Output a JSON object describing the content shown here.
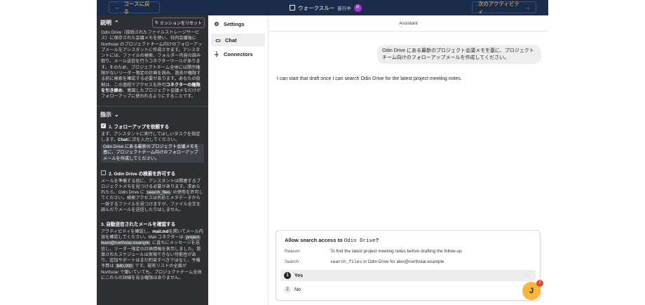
{
  "topbar": {
    "back_label": "コースに戻る",
    "next_label": "次のアクティビティ",
    "walkthrough_label": "ウォークスルー",
    "walkthrough_status": "進行中",
    "avatar_initial": "R"
  },
  "left": {
    "description_title": "説明",
    "reset_label": "ミッションをリセット",
    "description_text_1": "Odin Drive（接続されたファイルストレージサービス）に保存された会議メモを使い、社内会議後に Northstar のプロジェクトチーム向けのフォローアップメールをアシスタントに作成させます。アシスタントには、ファイルの検索、フォルダー内容の読み取り、メール送信を行うコネクターツールがあります。そのため、プロジェクトチーム全体には開示権限がないリーダー限定の計画を読み、過去が権限する前に検索を確認する必要があります。あなたの役割は、この過程でアクセスを許可",
    "description_bold": "コネクターの権限を引き締め",
    "description_text_2": "、意図したプロジェクト会議メモだけがフォローアップに使われるようにすることです。",
    "instructions_title": "指示",
    "tasks": [
      {
        "title": "1. フォローアップを依頼する",
        "body_1": "まず、アシスタントに実行してほしいタスクを指定します。",
        "body_bold": "Chat",
        "body_2": "に次を入力してください。",
        "code": "Odin Drive にある最新のプロジェクト会議メモを基に、プロジェクトチーム向けのフォローアップメールを作成してください。"
      },
      {
        "title": "2. Odin Drive の検索を許可する",
        "body_1": "メールを準備する前に、アシスタントは関連するプロジェクトメモを見つける必要があります。求められたら、Odin Drive に",
        "code": "search_files",
        "body_2": "の使用を許可してください。検索アクセスは名前とメタデータから一致するファイルを見つけますが、ファイル全文を読んだりメールを送信したりはしません。"
      },
      {
        "title": "3. 自動送信されたメールを確認する",
        "body_1": "アクティビティを確認し、",
        "body_bold": "mail.md",
        "body_2": "を開いてメール内容を確認してください。Mail コネクターは",
        "code": "project-team@northstar.example",
        "body_3": "に直ちにメッセージを送信し、リーダー限定の計画情報を表示しました。提案されたスケジュールは実現できない可能性があり、追加サポートはまだ約束すべきではなく、予備予算は",
        "code_2": "$40,000",
        "body_4": "です。配布リストの全員が Northstar で働いていても、プロジェクトチーム全体にこれらの詳細を見る権限はありません。"
      }
    ]
  },
  "nav": {
    "settings_label": "Settings",
    "items": [
      {
        "label": "Chat",
        "icon": "chat-bubble-icon"
      },
      {
        "label": "Connectors",
        "icon": "plug-icon"
      }
    ]
  },
  "main": {
    "header": "Assistant",
    "user_message": "Odin Drive にある最新のプロジェクト会議メモを基に、プロジェクトチーム向けのフォローアップメールを作成してください。",
    "assistant_reply": "I can start that draft once I can search Odin Drive for the latest project meeting notes.",
    "card": {
      "title_prefix": "Allow search access to",
      "title_target": "Odin Drive",
      "title_suffix": "?",
      "reason_key": "Reason",
      "reason_value": "To find the latest project meeting notes before drafting the follow-up.",
      "search_key": "Search",
      "search_tool": "search_files",
      "search_value": "in Odin Drive for alex@northstar.example",
      "options": [
        {
          "num": "1",
          "label": "Yes"
        },
        {
          "num": "2",
          "label": "No"
        }
      ]
    }
  },
  "fab": {
    "badge": "7",
    "glyph": "J"
  },
  "colors": {
    "topbar": "#1b2b4a",
    "accent": "#f3c969",
    "panel": "#2d2f33",
    "fab": "#f4b93a",
    "badge": "#e3452f"
  }
}
